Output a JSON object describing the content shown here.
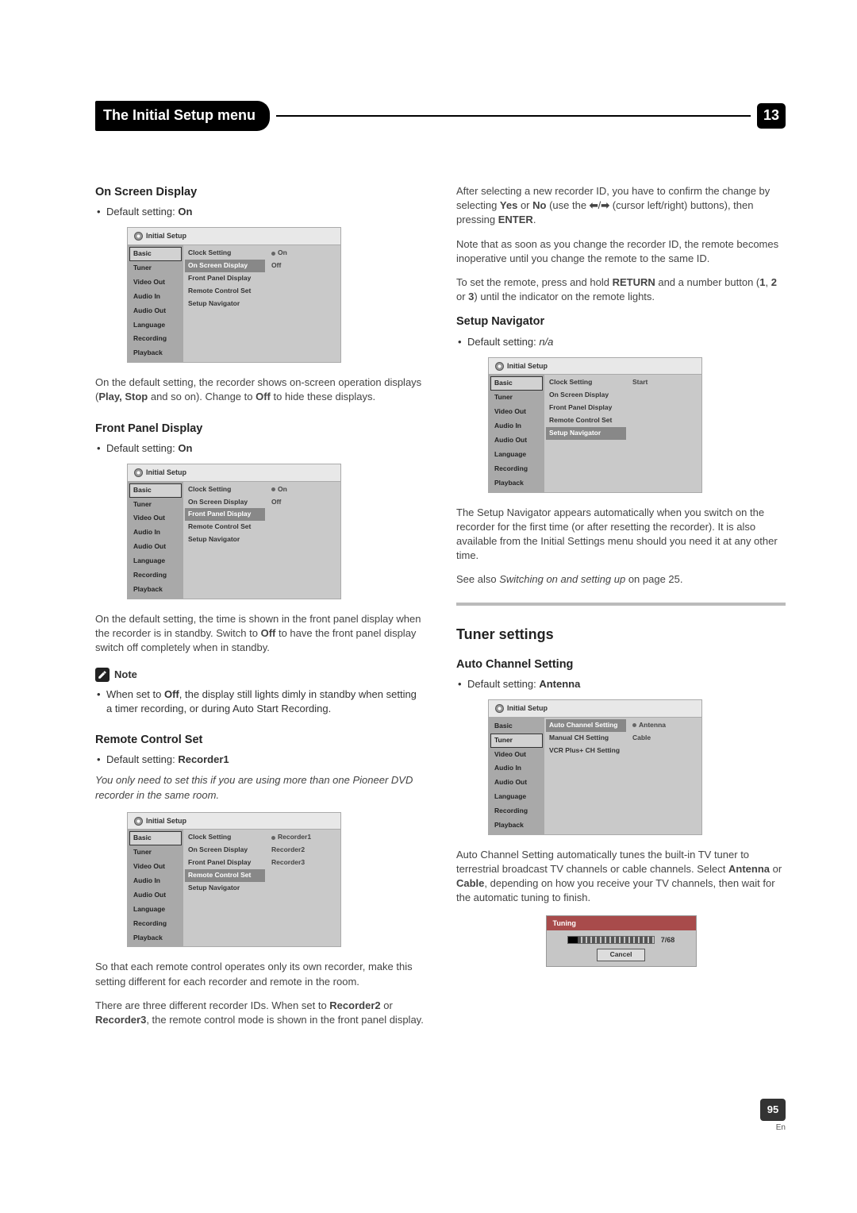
{
  "header": {
    "title": "The Initial Setup menu",
    "chapter": "13"
  },
  "osd_common": {
    "window_title": "Initial Setup",
    "left": [
      "Basic",
      "Tuner",
      "Video Out",
      "Audio In",
      "Audio Out",
      "Language",
      "Recording",
      "Playback"
    ],
    "center_basic": [
      "Clock Setting",
      "On Screen Display",
      "Front Panel Display",
      "Remote Control Set",
      "Setup Navigator"
    ],
    "center_tuner": [
      "Auto Channel Setting",
      "Manual CH Setting",
      "VCR Plus+ CH Setting"
    ]
  },
  "left_col": {
    "osd": {
      "heading": "On Screen Display",
      "default_prefix": "Default setting: ",
      "default_value": "On",
      "para_a": "On the default setting, the recorder shows on-screen operation displays (",
      "para_b": "Play, Stop",
      "para_c": " and so on). Change to ",
      "para_d": "Off",
      "para_e": " to hide these displays.",
      "options": [
        "On",
        "Off"
      ],
      "selected_left": "Basic",
      "selected_center": "On Screen Display"
    },
    "fpd": {
      "heading": "Front Panel Display",
      "default_prefix": "Default setting: ",
      "default_value": "On",
      "para_a": "On the default setting, the time is shown in the front panel display when the recorder is in standby. Switch to ",
      "para_b": "Off",
      "para_c": " to have the front panel display switch off completely when in standby.",
      "options": [
        "On",
        "Off"
      ],
      "selected_center": "Front Panel Display"
    },
    "note": {
      "label": "Note",
      "text_a": "When set to ",
      "text_b": "Off",
      "text_c": ", the display still lights dimly in standby when setting a timer recording, or during Auto Start Recording."
    },
    "rcs": {
      "heading": "Remote Control Set",
      "default_prefix": "Default setting: ",
      "default_value": "Recorder1",
      "intro": "You only need to set this if you are using more than one Pioneer DVD recorder in the same room.",
      "options": [
        "Recorder1",
        "Recorder2",
        "Recorder3"
      ],
      "selected_center": "Remote Control Set",
      "p1": "So that each remote control operates only its own recorder, make this setting different for each recorder and remote in the room.",
      "p2_a": "There are three different recorder IDs. When set to ",
      "p2_b": "Recorder2",
      "p2_c": " or ",
      "p2_d": "Recorder3",
      "p2_e": ", the remote control mode is shown in the front panel display."
    }
  },
  "right_col": {
    "confirm_a": "After selecting a new recorder ID, you have to confirm the change by selecting ",
    "confirm_b": "Yes",
    "confirm_c": " or ",
    "confirm_d": "No",
    "confirm_e": " (use the ",
    "confirm_f": " (cursor left/right) buttons), then pressing ",
    "confirm_g": "ENTER",
    "confirm_h": ".",
    "inop": "Note that as soon as you change the recorder ID, the remote becomes inoperative until you change the remote to the same ID.",
    "set_a": "To set the remote, press and hold ",
    "set_b": "RETURN",
    "set_c": " and a number button (",
    "set_d": "1",
    "set_e": ", ",
    "set_f": "2",
    "set_g": " or ",
    "set_h": "3",
    "set_i": ") until the indicator on the remote lights.",
    "nav": {
      "heading": "Setup Navigator",
      "default_prefix": "Default setting: ",
      "default_value": "n/a",
      "option": "Start",
      "selected_center": "Setup Navigator",
      "p1": "The Setup Navigator appears automatically when you switch on the recorder for the first time (or after resetting the recorder). It is also available from the Initial Settings menu should you need it at any other time.",
      "seealso_a": "See also ",
      "seealso_b": "Switching on and setting up",
      "seealso_c": " on page 25."
    },
    "tuner": {
      "section": "Tuner settings",
      "acs": {
        "heading": "Auto Channel Setting",
        "default_prefix": "Default setting: ",
        "default_value": "Antenna",
        "options": [
          "Antenna",
          "Cable"
        ],
        "selected_left": "Tuner",
        "selected_center": "Auto Channel Setting",
        "p_a": "Auto Channel Setting automatically tunes the built-in TV tuner to terrestrial broadcast TV channels or cable channels. Select ",
        "p_b": "Antenna",
        "p_c": " or ",
        "p_d": "Cable",
        "p_e": ", depending on how you receive your TV channels, then wait for the automatic tuning to finish."
      },
      "tuning": {
        "title": "Tuning",
        "count": "7/68",
        "cancel": "Cancel"
      }
    }
  },
  "footer": {
    "page": "95",
    "lang": "En"
  }
}
